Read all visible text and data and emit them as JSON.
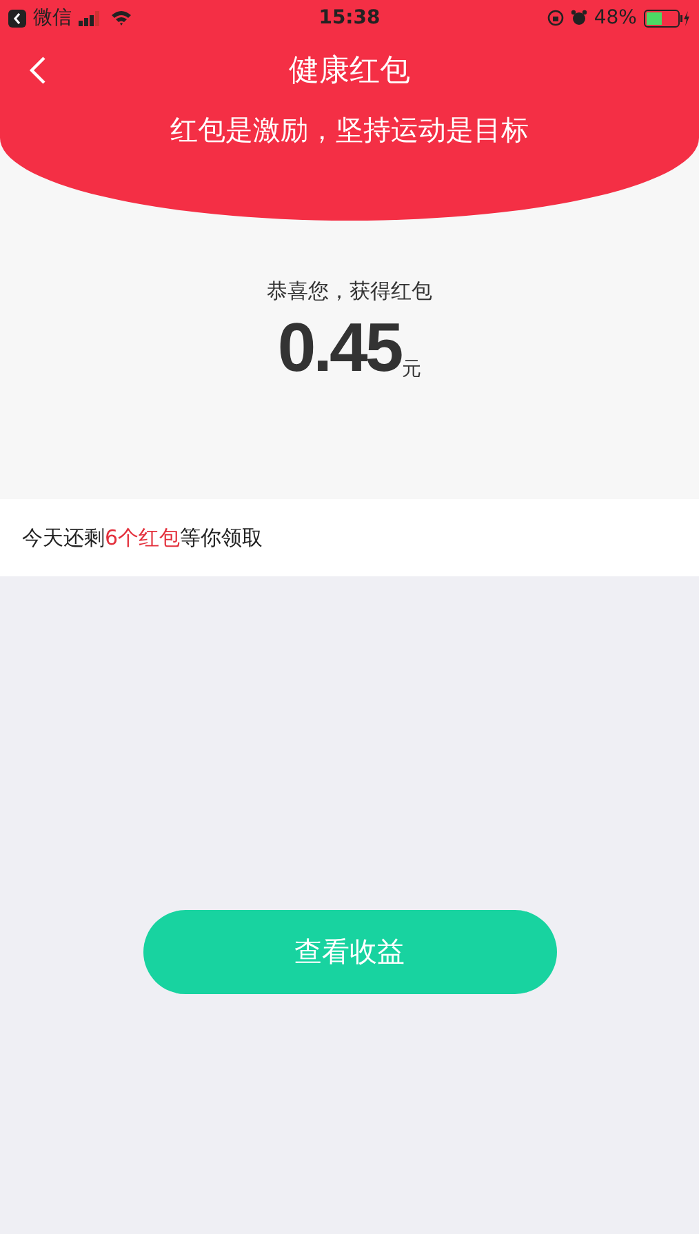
{
  "status_bar": {
    "back_app": "微信",
    "time": "15:38",
    "battery": "48%"
  },
  "header": {
    "title": "健康红包",
    "subtitle": "红包是激励，坚持运动是目标"
  },
  "reward": {
    "caption": "恭喜您，获得红包",
    "amount": "0.45",
    "unit": "元"
  },
  "remaining": {
    "before": "今天还剩",
    "highlight": "6个红包",
    "after": "等你领取"
  },
  "button": "查看收益"
}
